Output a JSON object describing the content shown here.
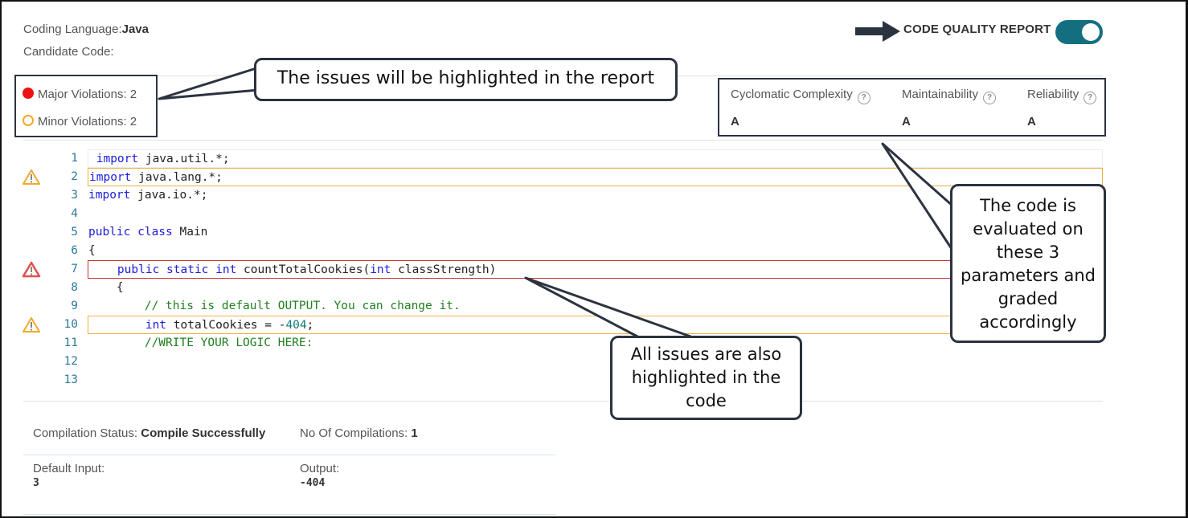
{
  "header": {
    "coding_language_label": "Coding Language:",
    "coding_language_value": "Java",
    "candidate_code_label": "Candidate Code:",
    "code_quality_report_label": "CODE QUALITY REPORT",
    "code_quality_report_enabled": true
  },
  "violations": {
    "major_label": "Major Violations: 2",
    "minor_label": "Minor Violations: 2",
    "major_color": "#ee1111",
    "minor_color": "#f0a92a"
  },
  "metrics": [
    {
      "name": "Cyclomatic Complexity",
      "grade": "A",
      "help_icon": "?"
    },
    {
      "name": "Maintainability",
      "grade": "A",
      "help_icon": "?"
    },
    {
      "name": "Reliability",
      "grade": "A",
      "help_icon": "?"
    }
  ],
  "code": {
    "lines": [
      {
        "n": "1",
        "highlight": "active",
        "warning": null
      },
      {
        "n": "2",
        "highlight": "minor",
        "warning": "minor"
      },
      {
        "n": "3",
        "highlight": null,
        "warning": null
      },
      {
        "n": "4",
        "highlight": null,
        "warning": null
      },
      {
        "n": "5",
        "highlight": null,
        "warning": null
      },
      {
        "n": "6",
        "highlight": null,
        "warning": null
      },
      {
        "n": "7",
        "highlight": "major",
        "warning": "major"
      },
      {
        "n": "8",
        "highlight": null,
        "warning": null
      },
      {
        "n": "9",
        "highlight": null,
        "warning": null
      },
      {
        "n": "10",
        "highlight": "minor",
        "warning": "minor"
      },
      {
        "n": "11",
        "highlight": null,
        "warning": null
      },
      {
        "n": "12",
        "highlight": null,
        "warning": null
      },
      {
        "n": "13",
        "highlight": null,
        "warning": null
      }
    ],
    "tokens": {
      "l1_kw": " import",
      "l1_rest": " java.util.*;",
      "l2_kw": "import",
      "l2_rest": " java.lang.*;",
      "l3_kw": "import",
      "l3_rest": " java.io.*;",
      "l5_kw": "public class",
      "l5_rest": " Main",
      "l6": "{",
      "l7_indent": "    ",
      "l7_kw": "public static int",
      "l7_mid": " countTotalCookies(",
      "l7_kw2": "int",
      "l7_rest": " classStrength)",
      "l8": "    {",
      "l9_indent": "        ",
      "l9_cm": "// this is default OUTPUT. You can change it.",
      "l10_indent": "        ",
      "l10_kw": "int",
      "l10_mid": " totalCookies = -",
      "l10_num": "404",
      "l10_rest": ";",
      "l11_indent": "        ",
      "l11_cm": "//WRITE YOUR LOGIC HERE:"
    }
  },
  "results": {
    "compilation_status_label": "Compilation Status: ",
    "compilation_status_value": "Compile Successfully",
    "compilations_label": "No Of Compilations: ",
    "compilations_value": "1",
    "default_input_label": "Default Input:",
    "default_input_value": "3",
    "output_label": "Output:",
    "output_value": "-404"
  },
  "callouts": {
    "report": "The issues will be highlighted in the report",
    "code": "All issues are also highlighted in the code",
    "params": "The code is evaluated on these 3 parameters and graded accordingly"
  }
}
